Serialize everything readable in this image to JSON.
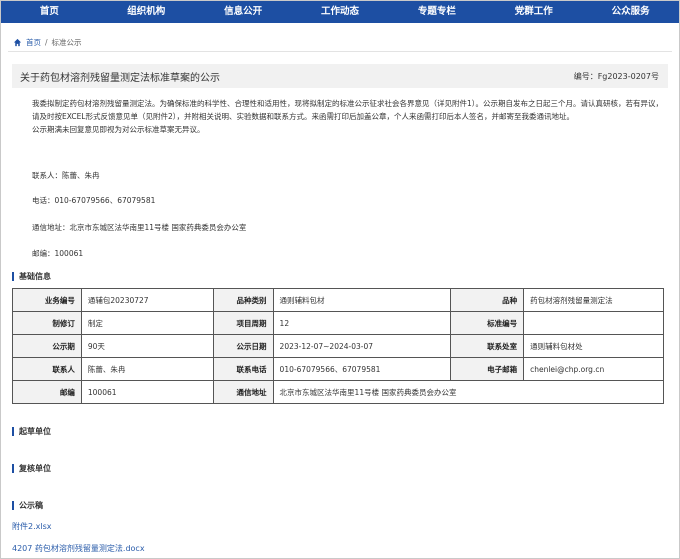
{
  "nav": [
    "首页",
    "组织机构",
    "信息公开",
    "工作动态",
    "专题专栏",
    "党群工作",
    "公众服务"
  ],
  "breadcrumb": {
    "home": "首页",
    "sep": "/",
    "current": "标准公示"
  },
  "title": "关于药包材溶剂残留量测定法标准草案的公示",
  "code": "编号：Fg2023-0207号",
  "notice": {
    "para1": "我委拟制定药包材溶剂残留量测定法。为确保标准的科学性、合理性和适用性，现将拟制定的标准公示征求社会各界意见（详见附件1）。公示期自发布之日起三个月。请认真研核，若有异议，请及时按EXCEL形式反馈意见单（见附件2），并附相关说明、实验数据和联系方式。来函需打印后加盖公章，个人来函需打印后本人签名，并邮寄至我委通讯地址。",
    "para2": "公示期满未回复意见即视为对公示标准草案无异议。"
  },
  "contact": {
    "person": "联系人：陈蕾、朱冉",
    "phone": "电话：010-67079566、67079581",
    "address": "通信地址：北京市东城区法华南里11号楼  国家药典委员会办公室",
    "postcode": "邮编：100061"
  },
  "sections": {
    "basic": "基础信息",
    "draft_unit": "起草单位",
    "review_unit": "复核单位",
    "public_draft": "公示稿"
  },
  "table": [
    [
      "业务编号",
      "通辅包20230727",
      "品种类别",
      "通则辅料包材",
      "品种",
      "药包材溶剂残留量测定法"
    ],
    [
      "制修订",
      "制定",
      "项目周期",
      "12",
      "标准编号",
      ""
    ],
    [
      "公示期",
      "90天",
      "公示日期",
      "2023-12-07~2024-03-07",
      "联系处室",
      "通则辅料包材处"
    ],
    [
      "联系人",
      "陈蕾、朱冉",
      "联系电话",
      "010-67079566、67079581",
      "电子邮箱",
      "chenlei@chp.org.cn"
    ],
    [
      "邮编",
      "100061",
      "通信地址",
      "北京市东城区法华南里11号楼 国家药典委员会办公室"
    ]
  ],
  "files": [
    "附件2.xlsx",
    "4207 药包材溶剂残留量测定法.docx"
  ]
}
